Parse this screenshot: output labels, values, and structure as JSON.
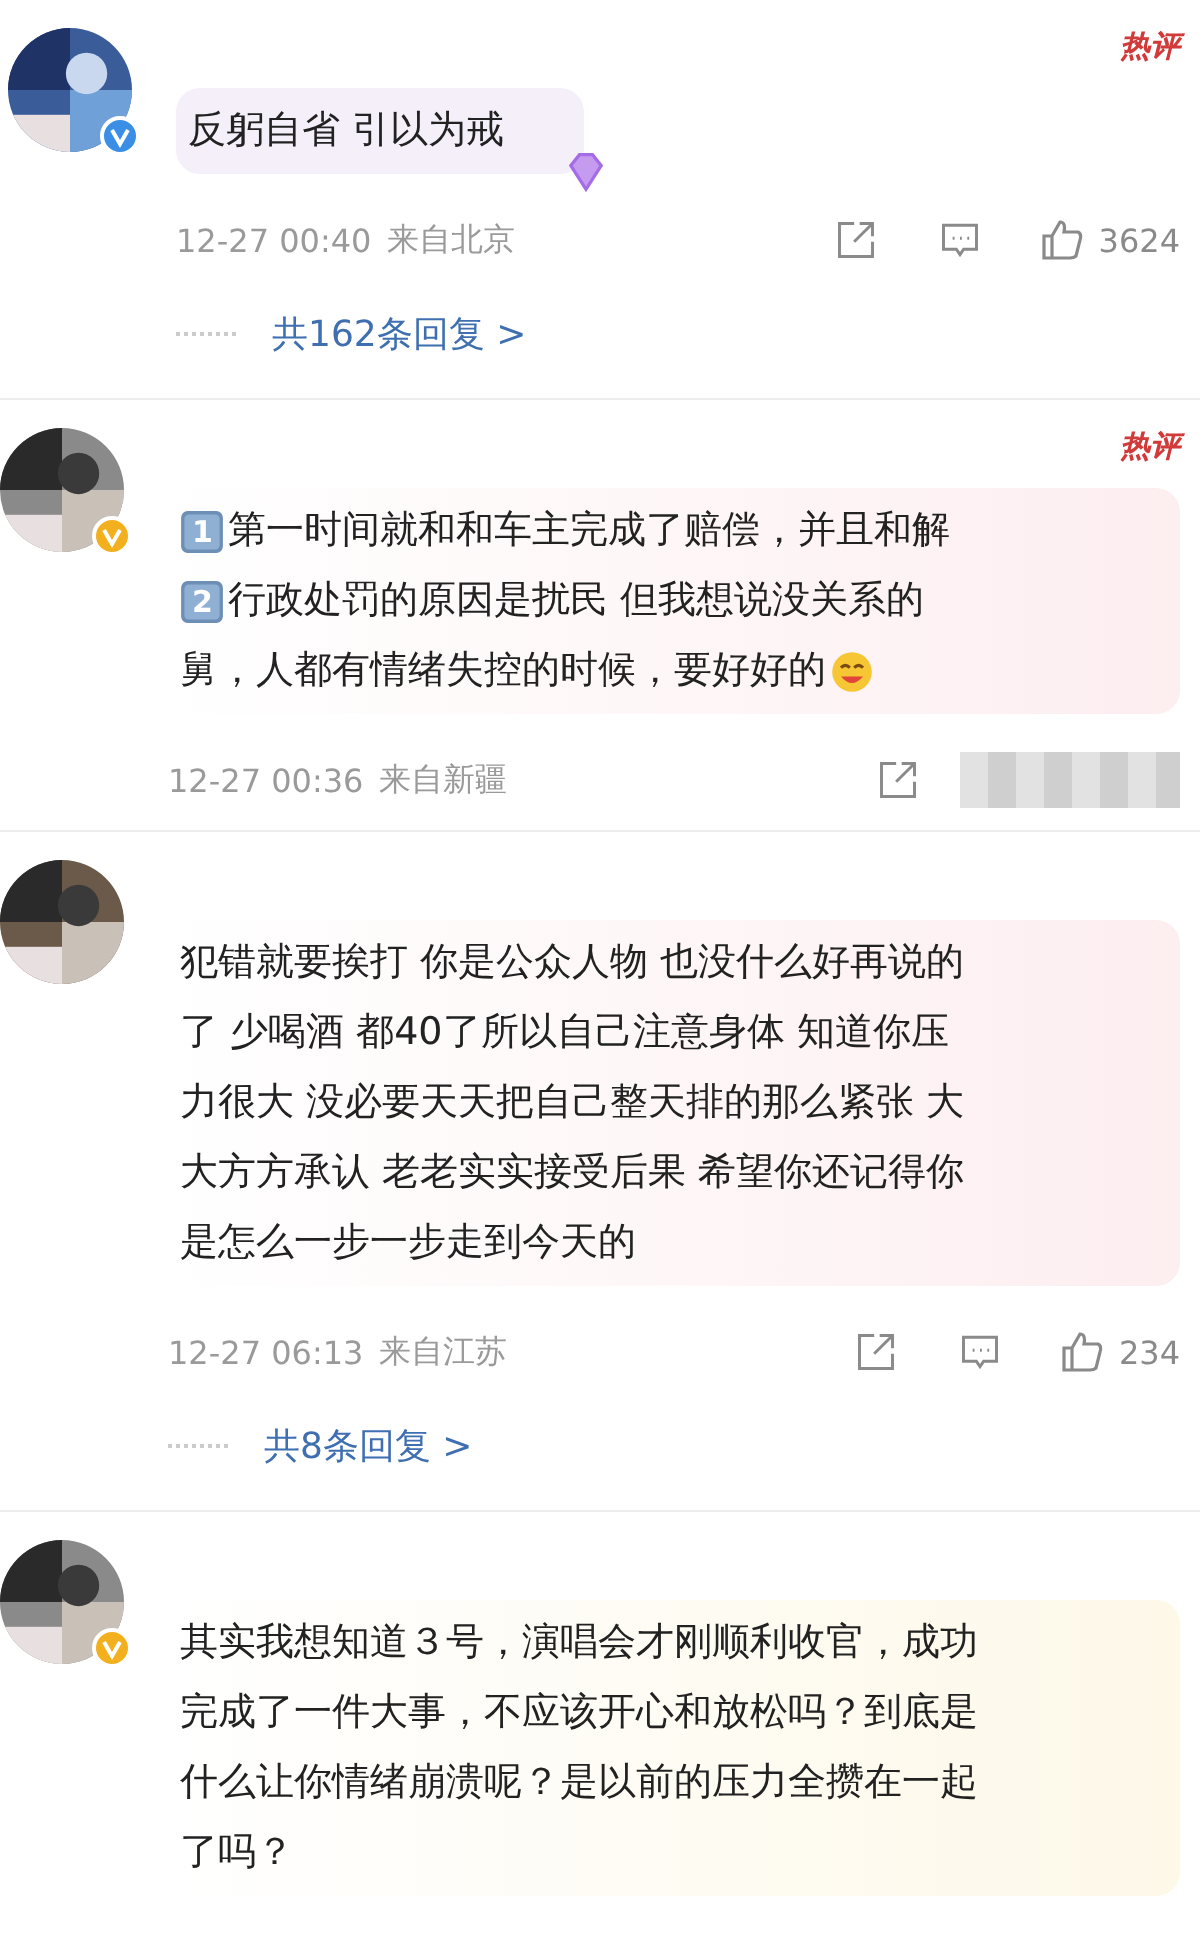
{
  "comments": [
    {
      "hot": "热评",
      "verified_badge": {
        "color": "#3a8ee6"
      },
      "bubble": {
        "color": "#f4eff8"
      },
      "gem": true,
      "lines": [
        {
          "text": "反躬自省  引以为戒"
        }
      ],
      "time": "12-27 00:40",
      "location": "来自北京",
      "likes": "3624",
      "replies": "共162条回复 >"
    },
    {
      "hot": "热评",
      "verified_badge": {
        "color": "#f2b01e"
      },
      "bubble": {
        "color": "#fdeef0"
      },
      "lines": [
        {
          "number": "1",
          "text": "第一时间就和和车主完成了赔偿，并且和解"
        },
        {
          "number": "2",
          "text": "行政处罚的原因是扰民 但我想说没关系的"
        },
        {
          "text": "舅，人都有情绪失控的时候，要好好的",
          "emoji": true
        }
      ],
      "time": "12-27 00:36",
      "location": "来自新疆",
      "censored": true
    },
    {
      "bubble": {
        "color": "#fdeef0"
      },
      "lines": [
        {
          "text": "犯错就要挨打 你是公众人物 也没什么好再说的"
        },
        {
          "text": "了 少喝酒 都40了所以自己注意身体 知道你压"
        },
        {
          "text": "力很大 没必要天天把自己整天排的那么紧张 大"
        },
        {
          "text": "大方方承认 老老实实接受后果 希望你还记得你"
        },
        {
          "text": "是怎么一步一步走到今天的"
        }
      ],
      "time": "12-27 06:13",
      "location": "来自江苏",
      "likes": "234",
      "replies": "共8条回复 >"
    },
    {
      "verified_badge": {
        "color": "#f2b01e"
      },
      "bubble": {
        "color": "#fdf8e8"
      },
      "lines": [
        {
          "text": "其实我想知道３号，演唱会才刚顺利收官，成功"
        },
        {
          "text": "完成了一件大事，不应该开心和放松吗？到底是"
        },
        {
          "text": "什么让你情绪崩溃呢？是以前的压力全攒在一起"
        },
        {
          "text": "了吗？"
        }
      ]
    }
  ]
}
